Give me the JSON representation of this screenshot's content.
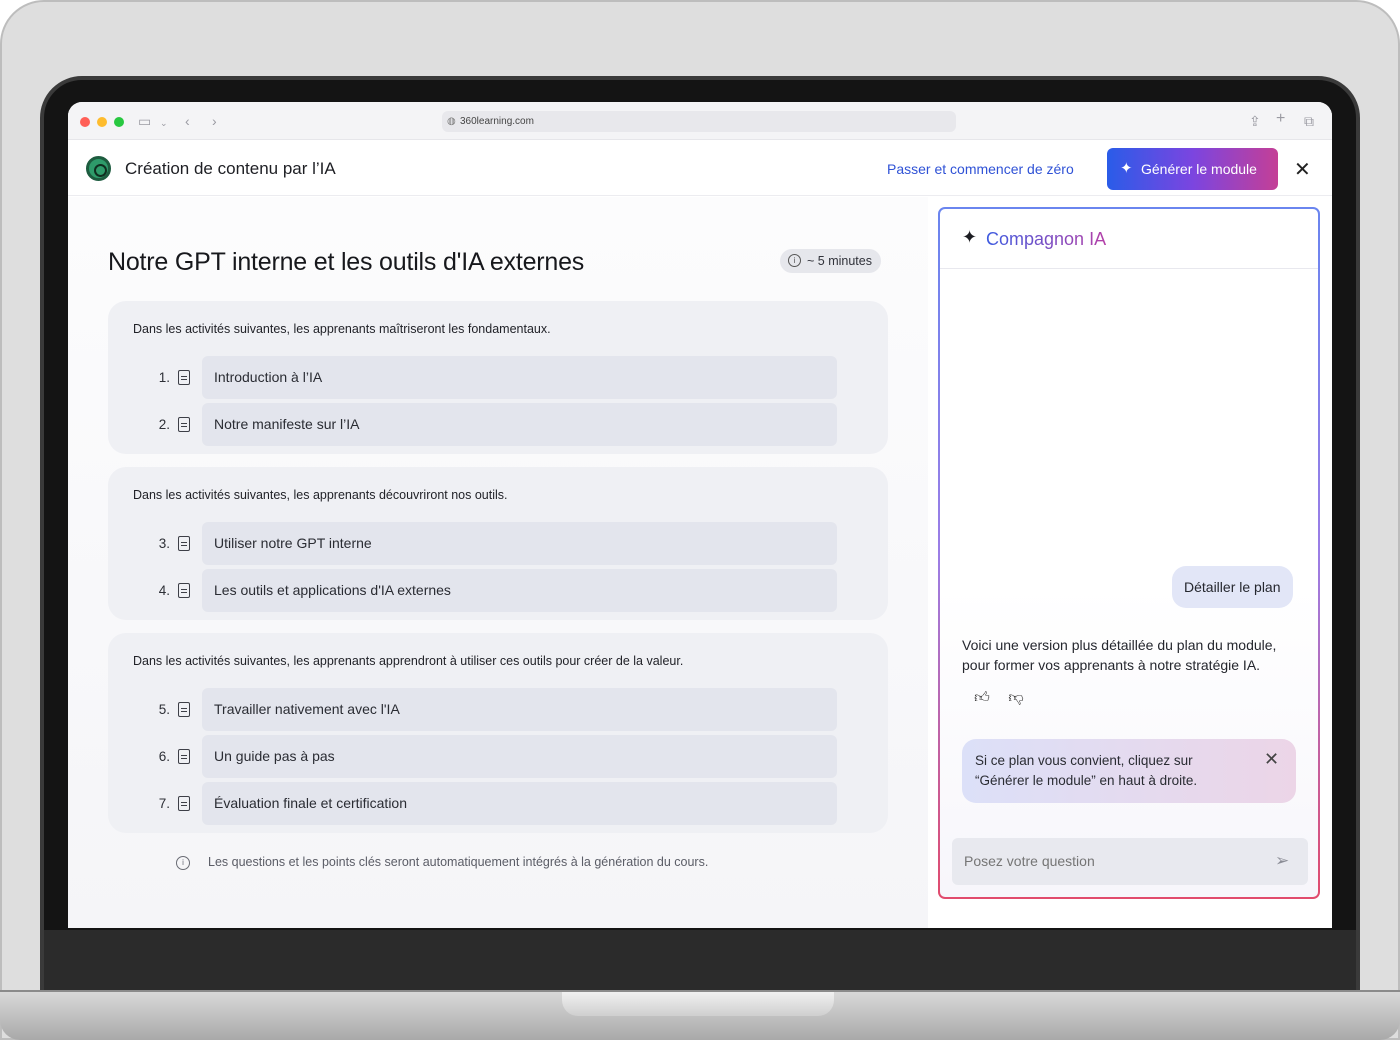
{
  "browser": {
    "url": "360learning.com"
  },
  "header": {
    "title": "Création de contenu par l’IA",
    "skip_label": "Passer et commencer de zéro",
    "generate_label": "Générer le module"
  },
  "module": {
    "title": "Notre GPT interne et les outils d'IA externes",
    "duration": "~ 5 minutes",
    "sections": [
      {
        "label": "Dans les activités suivantes, les apprenants maîtriseront les fondamentaux.",
        "activities": [
          {
            "num": "1.",
            "title": "Introduction à l’IA"
          },
          {
            "num": "2.",
            "title": "Notre manifeste sur l’IA"
          }
        ]
      },
      {
        "label": "Dans les activités suivantes, les apprenants découvriront nos outils.",
        "activities": [
          {
            "num": "3.",
            "title": "Utiliser notre GPT interne"
          },
          {
            "num": "4.",
            "title": "Les outils et applications d'IA externes"
          }
        ]
      },
      {
        "label": "Dans les activités suivantes, les apprenants apprendront à utiliser ces outils pour créer de la valeur.",
        "activities": [
          {
            "num": "5.",
            "title": "Travailler nativement avec l'IA"
          },
          {
            "num": "6.",
            "title": "Un guide pas à pas"
          },
          {
            "num": "7.",
            "title": "Évaluation finale et certification"
          }
        ]
      }
    ],
    "footnote": "Les questions et les points clés seront automatiquement intégrés à la génération du cours."
  },
  "assistant": {
    "title": "Compagnon IA",
    "user_message": "Détailler le plan",
    "ai_message": "Voici une version plus détaillée du plan du module, pour former vos apprenants à notre stratégie IA.",
    "tip": "Si ce plan vous convient, cliquez sur “Générer le module” en haut à droite.",
    "input_placeholder": "Posez votre question"
  },
  "colors": {
    "accent_blue": "#2f52d6",
    "gradient_start": "#2a5ce8",
    "gradient_end": "#c43f96"
  }
}
